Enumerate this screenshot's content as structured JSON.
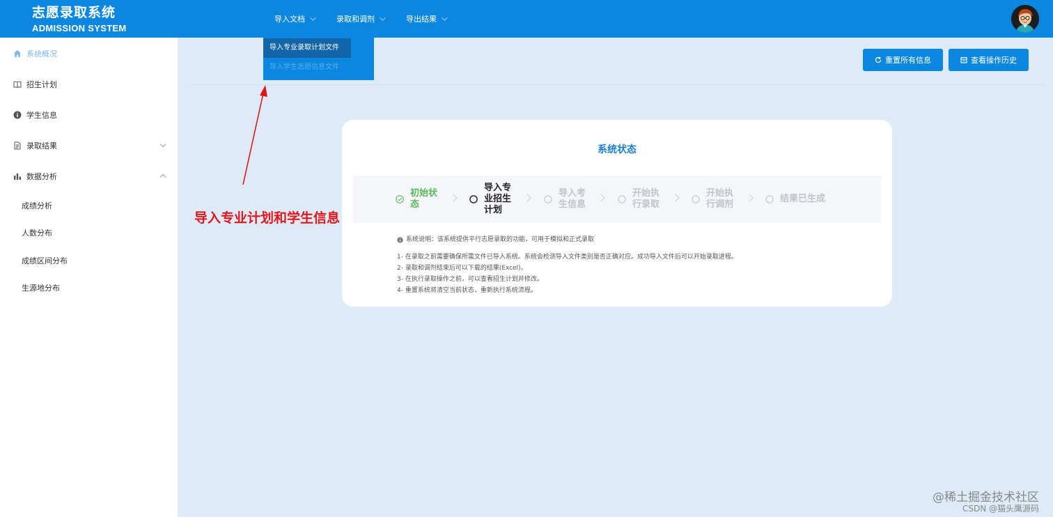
{
  "header": {
    "logo_cn": "志愿录取系统",
    "logo_en": "ADMISSION SYSTEM",
    "nav": [
      {
        "label": "导入文档"
      },
      {
        "label": "录取和调剂"
      },
      {
        "label": "导出结果"
      }
    ]
  },
  "dropdown": {
    "items": [
      {
        "label": "导入专业录取计划文件"
      },
      {
        "label": "导入学生志愿信息文件"
      }
    ]
  },
  "sidebar": {
    "items": [
      {
        "label": "系统概况",
        "icon": "home-icon"
      },
      {
        "label": "招生计划",
        "icon": "book-icon"
      },
      {
        "label": "学生信息",
        "icon": "info-icon"
      },
      {
        "label": "录取结果",
        "icon": "document-icon"
      },
      {
        "label": "数据分析",
        "icon": "bar-chart-icon"
      }
    ],
    "sub_items": [
      {
        "label": "成绩分析"
      },
      {
        "label": "人数分布"
      },
      {
        "label": "成绩区间分布"
      },
      {
        "label": "生源地分布"
      }
    ]
  },
  "toolbar": {
    "reset_label": "重置所有信息",
    "history_label": "查看操作历史"
  },
  "card": {
    "title": "系统状态",
    "steps": [
      {
        "label": "初始状态",
        "status": "done"
      },
      {
        "label": "导入专业招生计划",
        "status": "current"
      },
      {
        "label": "导入考生信息",
        "status": "wait"
      },
      {
        "label": "开始执行录取",
        "status": "wait"
      },
      {
        "label": "开始执行调剂",
        "status": "wait"
      },
      {
        "label": "结果已生成",
        "status": "wait"
      }
    ],
    "note_head": "系统说明：该系统提供平行志愿录取的功能，可用于模拟和正式录取",
    "notes": [
      "1- 在录取之前需要确保所需文件已导入系统。系统会检测导入文件类别是否正确对应。成功导入文件后可以开始录取进程。",
      "2- 录取和调剂结束后可以下载的结果(Excel)。",
      "3- 在执行录取操作之前，可以查看招生计划并修改。",
      "4- 重置系统将清空当前状态，重新执行系统流程。"
    ]
  },
  "annotation": {
    "text": "导入专业计划和学生信息",
    "color": "#e0161b"
  },
  "watermark": {
    "line1": "@稀土掘金技术社区",
    "line2": "CSDN @猫头鹰源码"
  },
  "colors": {
    "primary": "#0b87e0",
    "background": "#dcebf7",
    "done": "#5cb85c",
    "title_blue": "#1a7fd0"
  }
}
